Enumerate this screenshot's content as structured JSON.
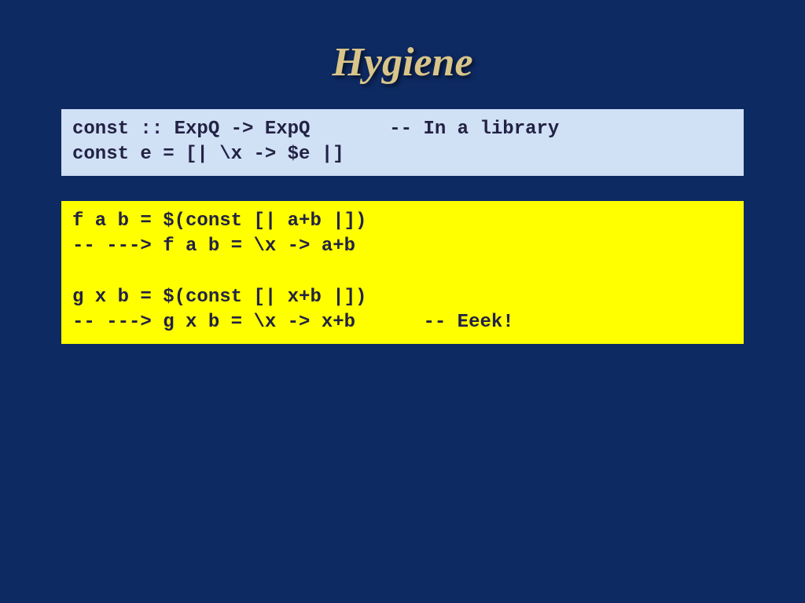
{
  "title": "Hygiene",
  "box1": {
    "line1": "const :: ExpQ -> ExpQ       -- In a library",
    "line2": "const e = [| \\x -> $e |]"
  },
  "box2": {
    "line1": "f a b = $(const [| a+b |])",
    "line2": "-- ---> f a b = \\x -> a+b",
    "line3": "",
    "line4": "g x b = $(const [| x+b |])",
    "line5": "-- ---> g x b = \\x -> x+b      -- Eeek!"
  }
}
